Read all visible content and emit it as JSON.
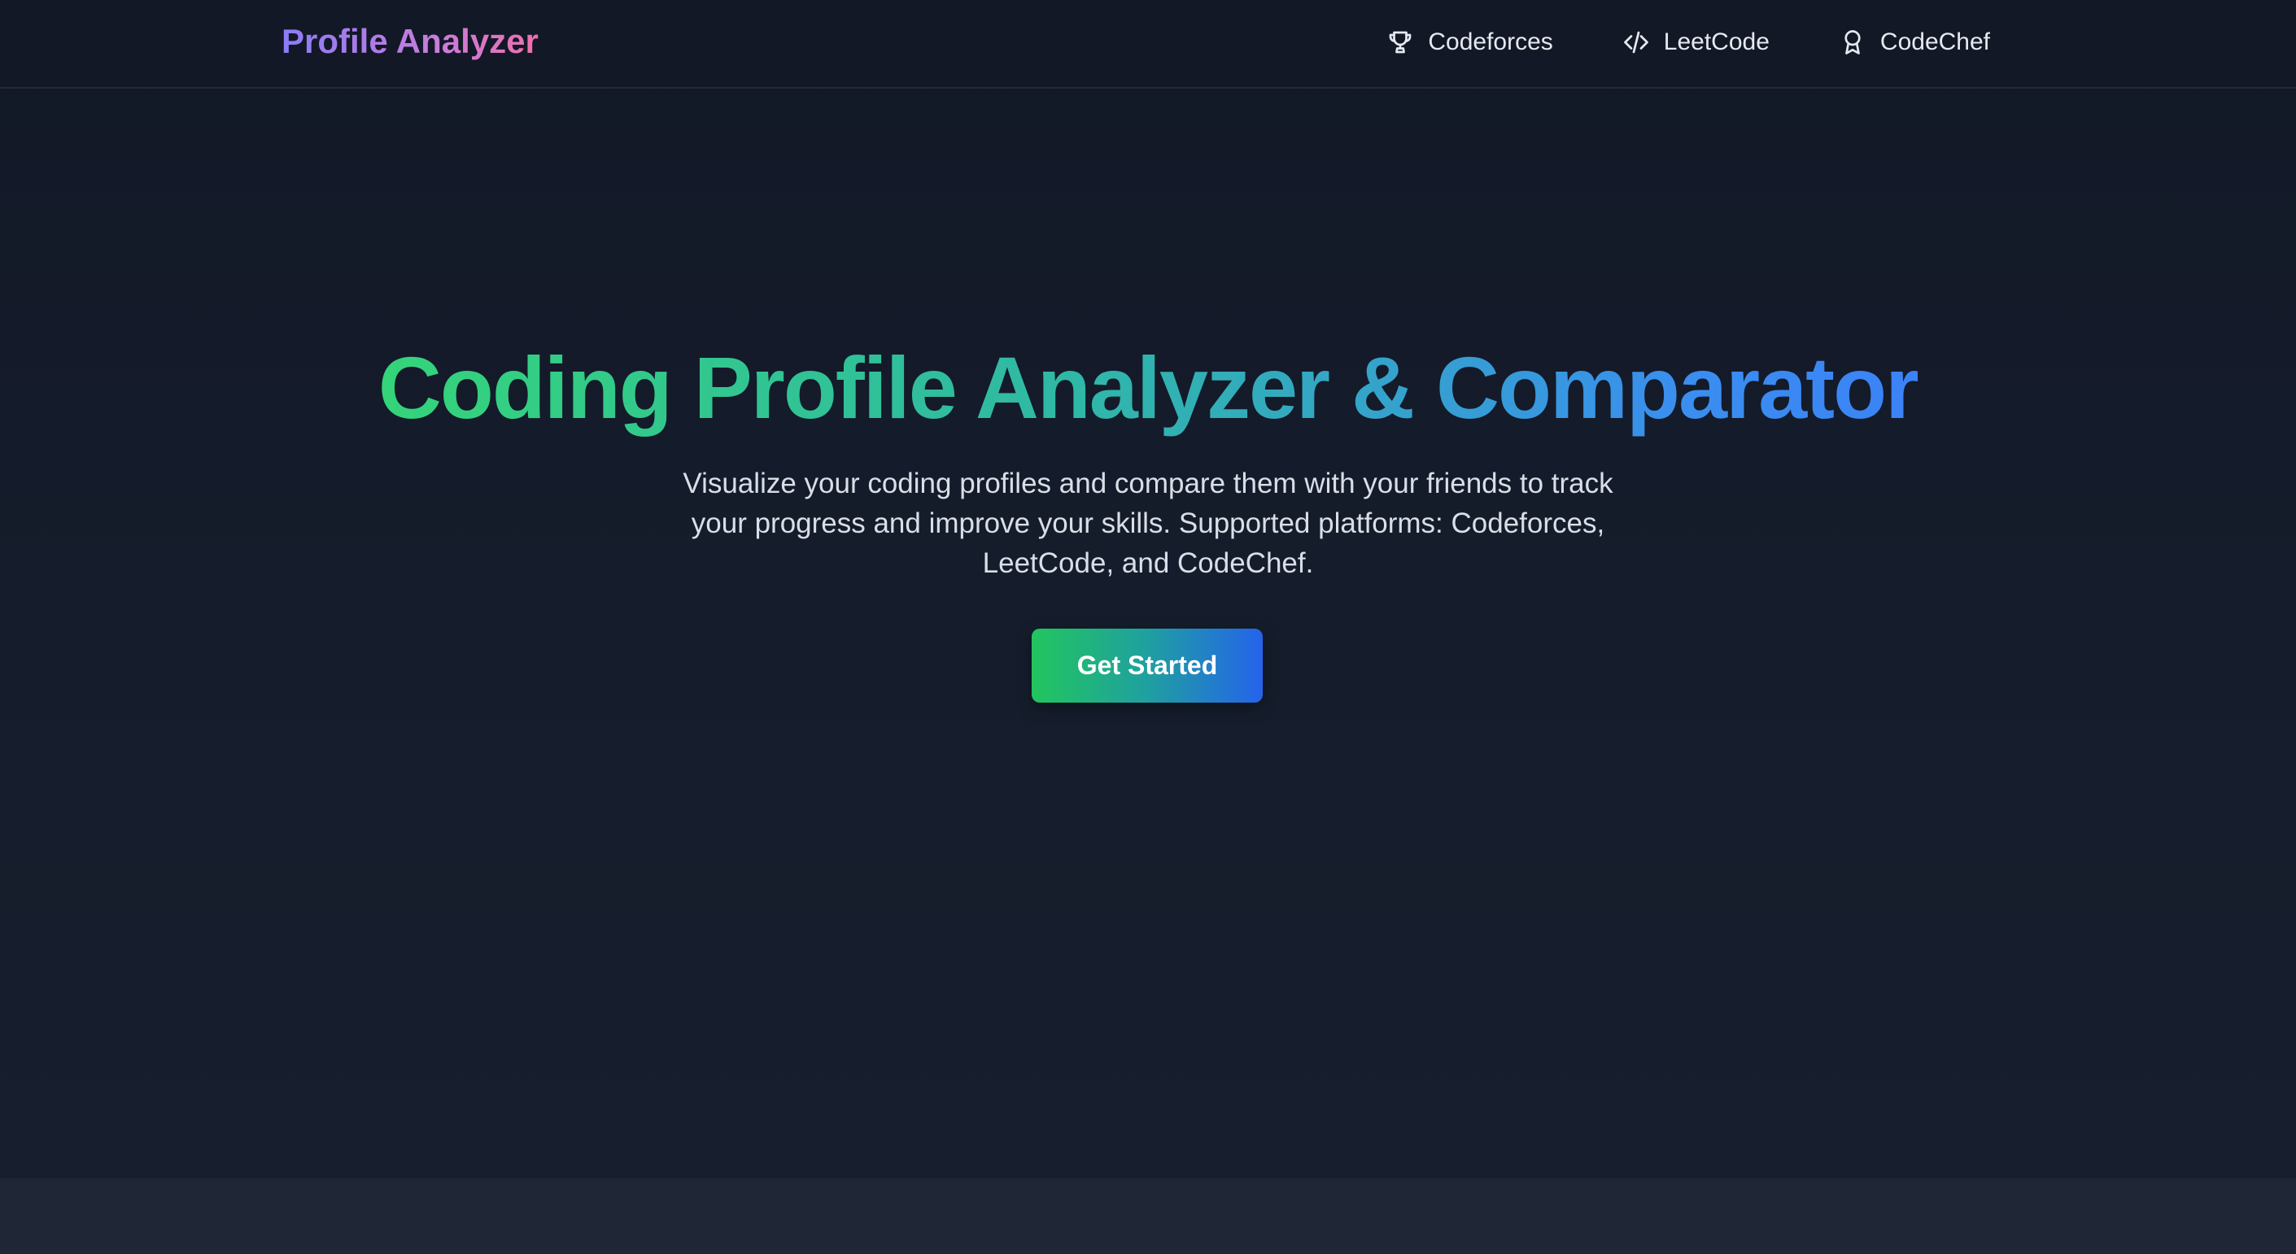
{
  "header": {
    "brand": "Profile Analyzer",
    "nav": [
      {
        "label": "Codeforces",
        "icon": "trophy-icon"
      },
      {
        "label": "LeetCode",
        "icon": "code-icon"
      },
      {
        "label": "CodeChef",
        "icon": "award-icon"
      }
    ]
  },
  "hero": {
    "title": "Coding Profile Analyzer & Comparator",
    "subtitle": "Visualize your coding profiles and compare them with your friends to track your progress and improve your skills. Supported platforms: Codeforces, LeetCode, and CodeChef.",
    "cta_label": "Get Started"
  },
  "colors": {
    "background": "#121826",
    "brand_gradient_start": "#8b7cf6",
    "brand_gradient_end": "#ef6fae",
    "title_gradient_start": "#34d47a",
    "title_gradient_end": "#3b82f6",
    "cta_gradient_start": "#22c55e",
    "cta_gradient_end": "#2563eb"
  }
}
